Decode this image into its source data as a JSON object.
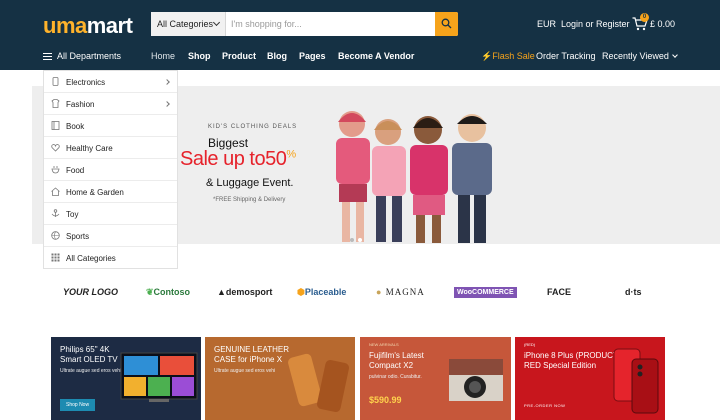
{
  "header": {
    "logo_part1": "uma",
    "logo_part2": "mart",
    "search": {
      "category": "All Categories",
      "placeholder": "I'm shopping for..."
    },
    "currency": "EUR",
    "login": "Login or Register",
    "cart_count": "0",
    "cart_total": "£ 0.00"
  },
  "nav": {
    "departments": "All Departments",
    "items": [
      "Home",
      "Shop",
      "Product",
      "Blog",
      "Pages",
      "Become A Vendor"
    ],
    "flash": "Flash Sale",
    "order": "Order Tracking",
    "recent": "Recently Viewed"
  },
  "departments": [
    {
      "label": "Electronics",
      "icon": "phone-icon",
      "arrow": true
    },
    {
      "label": "Fashion",
      "icon": "shirt-icon",
      "arrow": true
    },
    {
      "label": "Book",
      "icon": "book-icon",
      "arrow": false
    },
    {
      "label": "Healthy Care",
      "icon": "heart-icon",
      "arrow": false
    },
    {
      "label": "Food",
      "icon": "food-icon",
      "arrow": false
    },
    {
      "label": "Home & Garden",
      "icon": "house-icon",
      "arrow": false
    },
    {
      "label": "Toy",
      "icon": "toy-icon",
      "arrow": false
    },
    {
      "label": "Sports",
      "icon": "ball-icon",
      "arrow": false
    },
    {
      "label": "All Categories",
      "icon": "grid-icon",
      "arrow": false
    }
  ],
  "hero": {
    "kicker": "KID'S CLOTHING DEALS",
    "biggest": "Biggest",
    "sale": "Sale up to50",
    "percent": "%",
    "luggage": "& Luggage Event.",
    "shipping": "*FREE Shipping & Delivery"
  },
  "brands": [
    "YOUR LOGO",
    "Contoso",
    "demosport",
    "Placeable",
    "MAGNA",
    "WooCOMMERCE",
    "FACE",
    "d·ts"
  ],
  "promos": [
    {
      "title1": "Philips 65\" 4K",
      "title2": "Smart OLED TV",
      "sub": "Ultrate augue sed eros vehi",
      "button": "Shop Now",
      "bg": "#1d2b44"
    },
    {
      "title1": "GENUINE LEATHER",
      "title2": "CASE for iPhone X",
      "sub": "Ultrate augue sed eros vehi",
      "bg": "#b7692f"
    },
    {
      "kicker": "NEW ARRIVALS",
      "title1": "Fujifilm's Latest",
      "title2": "Compact X2",
      "sub": "pulvinar odio. Curabitur.",
      "price": "$590.99",
      "bg": "#c6573a"
    },
    {
      "kicker": "(RED)",
      "title1": "iPhone 8 Plus (PRODUCT)",
      "title2": "RED Special Edition",
      "cta": "PRE-ORDER NOW",
      "bg": "#c8161d"
    }
  ],
  "colors": {
    "header_bg": "#153144",
    "accent": "#f6a31b",
    "sale_red": "#e6222b"
  }
}
